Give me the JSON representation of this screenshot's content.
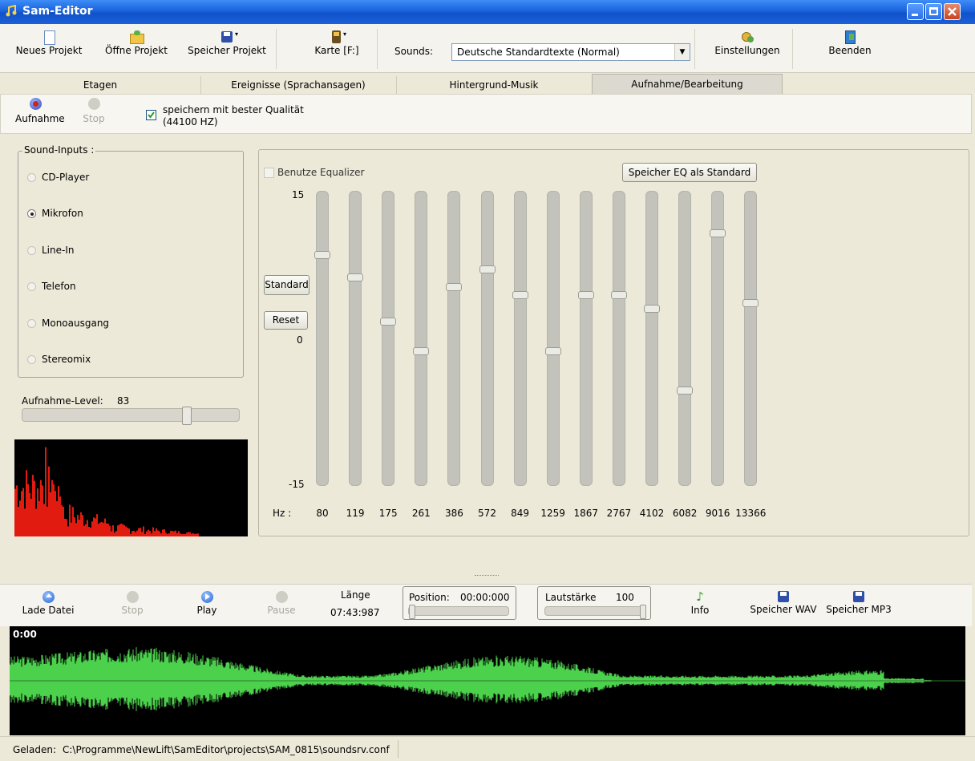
{
  "window": {
    "title": "Sam-Editor",
    "accent": "#1a63dd"
  },
  "toolbar": {
    "new_project": "Neues Projekt",
    "open_project": "Öffne Projekt",
    "save_project": "Speicher Projekt",
    "map": "Karte [F:]",
    "sounds_label": "Sounds:",
    "sounds_value": "Deutsche Standardtexte (Normal)",
    "settings": "Einstellungen",
    "quit": "Beenden"
  },
  "tabs": [
    {
      "label": "Etagen"
    },
    {
      "label": "Ereignisse (Sprachansagen)"
    },
    {
      "label": "Hintergrund-Musik"
    },
    {
      "label": "Aufnahme/Bearbeitung",
      "active": true
    }
  ],
  "record": {
    "record_label": "Aufnahme",
    "stop_label": "Stop",
    "quality_label": "speichern mit bester Qualität",
    "quality_hz": "(44100 HZ)",
    "quality_checked": true
  },
  "inputs": {
    "group_label": "Sound-Inputs :",
    "items": [
      {
        "label": "CD-Player",
        "selected": false,
        "disabled": false
      },
      {
        "label": "Mikrofon",
        "selected": true,
        "disabled": false
      },
      {
        "label": "Line-In",
        "selected": false,
        "disabled": false
      },
      {
        "label": "Telefon",
        "selected": false,
        "disabled": false
      },
      {
        "label": "Monoausgang",
        "selected": false,
        "disabled": false
      },
      {
        "label": "Stereomix",
        "selected": false,
        "disabled": false
      }
    ],
    "level_label": "Aufnahme-Level:",
    "level_value": "83",
    "level_fraction": 0.83
  },
  "equalizer": {
    "use_label": "Benutze Equalizer",
    "use_checked": false,
    "save_default_label": "Speicher EQ als Standard",
    "standard_label": "Standard",
    "reset_label": "Reset",
    "scale_top": "15",
    "scale_mid": "0",
    "scale_bottom": "-15",
    "hz_label": "Hz :",
    "bands": [
      {
        "hz": "80",
        "gain": 8.5
      },
      {
        "hz": "119",
        "gain": 6.2
      },
      {
        "hz": "175",
        "gain": 1.7
      },
      {
        "hz": "261",
        "gain": -1.3
      },
      {
        "hz": "386",
        "gain": 5.2
      },
      {
        "hz": "572",
        "gain": 7.0
      },
      {
        "hz": "849",
        "gain": 4.4
      },
      {
        "hz": "1259",
        "gain": -1.3
      },
      {
        "hz": "1867",
        "gain": 4.4
      },
      {
        "hz": "2767",
        "gain": 4.4
      },
      {
        "hz": "4102",
        "gain": 3.0
      },
      {
        "hz": "6082",
        "gain": -5.3
      },
      {
        "hz": "9016",
        "gain": 10.7
      },
      {
        "hz": "13366",
        "gain": 3.6
      }
    ]
  },
  "player": {
    "load_label": "Lade Datei",
    "stop_label": "Stop",
    "play_label": "Play",
    "pause_label": "Pause",
    "length_label": "Länge",
    "length_value": "07:43:987",
    "position_label": "Position:",
    "position_value": "00:00:000",
    "volume_label": "Lautstärke",
    "volume_value": "100",
    "volume_fraction": 1.0,
    "info_label": "Info",
    "save_wav_label": "Speicher WAV",
    "save_mp3_label": "Speicher MP3"
  },
  "waveform": {
    "time_label": "0:00",
    "color": "#4cd14c"
  },
  "spectrum": {
    "color": "#e21b10"
  },
  "status": {
    "loaded_label": "Geladen:",
    "path": "C:\\Programme\\NewLift\\SamEditor\\projects\\SAM_0815\\soundsrv.conf"
  }
}
